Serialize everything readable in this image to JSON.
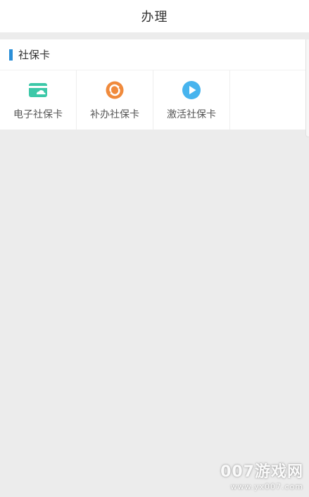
{
  "header": {
    "title": "办理"
  },
  "section": {
    "title": "社保卡",
    "items": [
      {
        "label": "电子社保卡",
        "icon": "card-icon",
        "color": "#3cc8a8"
      },
      {
        "label": "补办社保卡",
        "icon": "refresh-icon",
        "color": "#f08a3c"
      },
      {
        "label": "激活社保卡",
        "icon": "play-icon",
        "color": "#47b4ee"
      }
    ],
    "accent": "#2b8fd8"
  },
  "watermark": {
    "main": "007游戏网",
    "sub": "www.yx007.com"
  }
}
